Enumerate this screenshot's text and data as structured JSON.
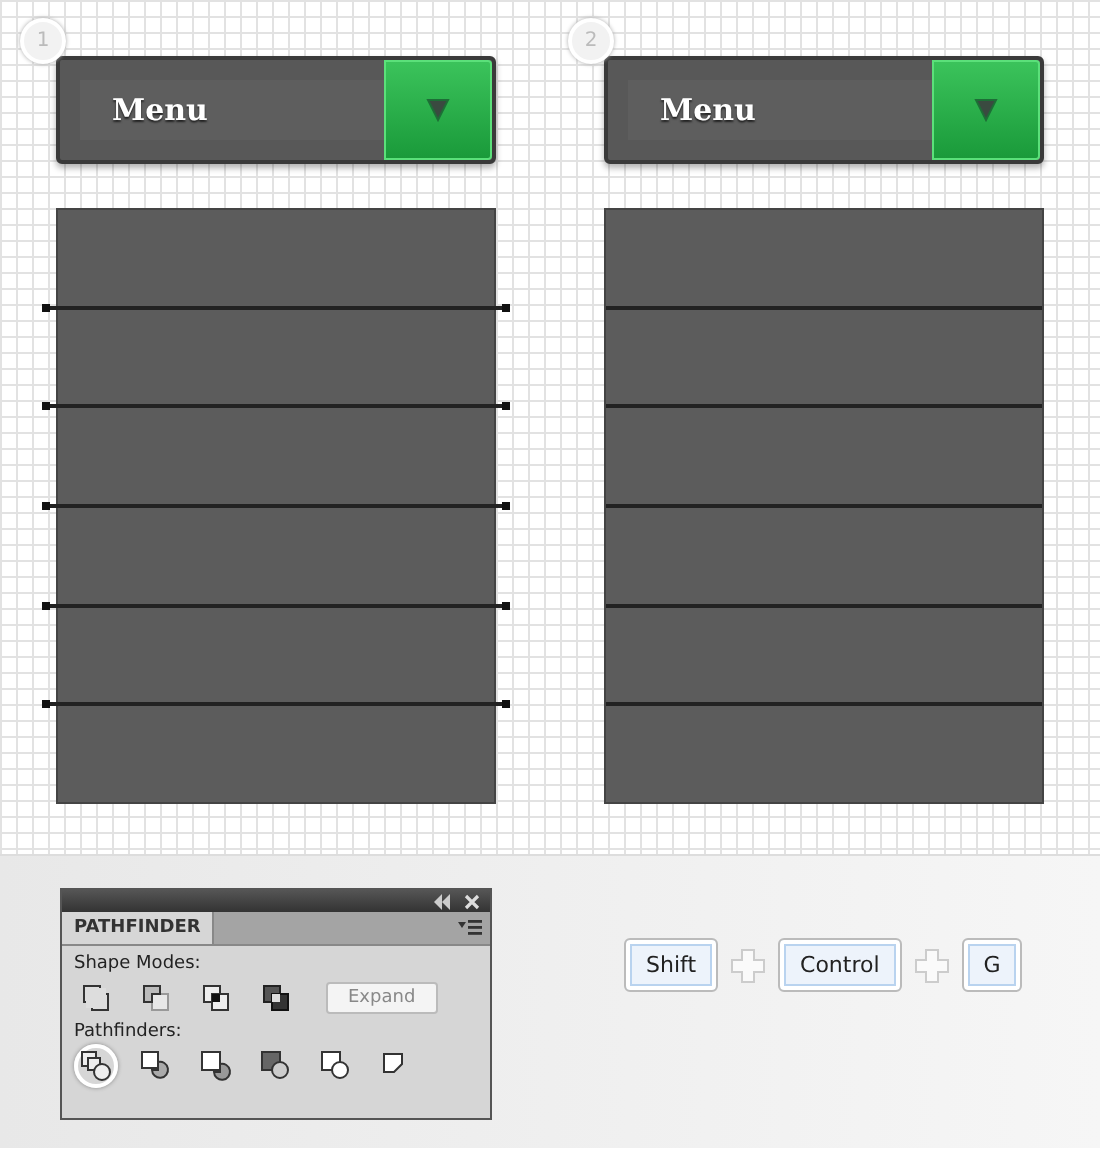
{
  "steps": [
    {
      "number": "1",
      "menu_label": "Menu",
      "lines_extended": true
    },
    {
      "number": "2",
      "menu_label": "Menu",
      "lines_extended": false
    }
  ],
  "pathfinder": {
    "title": "PATHFINDER",
    "shape_modes_label": "Shape Modes:",
    "expand_button": "Expand",
    "pathfinders_label": "Pathfinders:",
    "pathfinder_buttons": [
      {
        "selected": true
      },
      {
        "selected": false
      },
      {
        "selected": false
      },
      {
        "selected": false
      },
      {
        "selected": false
      },
      {
        "selected": false
      }
    ]
  },
  "shortcut": {
    "keys": [
      "Shift",
      "Control",
      "G"
    ]
  }
}
